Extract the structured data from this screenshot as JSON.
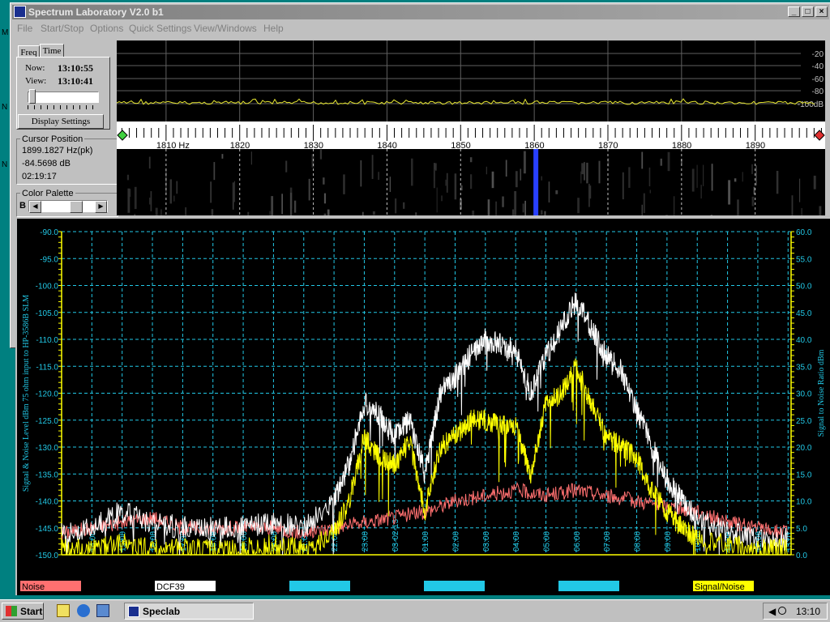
{
  "window": {
    "title": "Spectrum Laboratory V2.0 b1",
    "buttons": {
      "minimize": "_",
      "maximize": "□",
      "close": "×"
    }
  },
  "menu": [
    "File",
    "Start/Stop",
    "Options",
    "Quick Settings",
    "View/Windows",
    "Help"
  ],
  "left_panel": {
    "tabs": [
      "Freq",
      "Time"
    ],
    "now_label": "Now:",
    "now_value": "13:10:55",
    "view_label": "View:",
    "view_value": "13:10:41",
    "display_settings": "Display Settings",
    "cursor_title": "Cursor Position",
    "cursor_freq": "1899.1827 Hz(pk)",
    "cursor_level": "-84.5698 dB",
    "cursor_time": "02:19:17",
    "palette_title": "Color Palette",
    "palette_b": "B",
    "side_letters": [
      "M",
      "N",
      "N"
    ]
  },
  "spectrum": {
    "db_labels": [
      "-20",
      "-40",
      "-60",
      "-80",
      "-100dB"
    ],
    "freq_labels": [
      "1810 Hz",
      "1820",
      "1830",
      "1840",
      "1850",
      "1860",
      "1870",
      "1880",
      "1890"
    ],
    "freq_values": [
      1810,
      1820,
      1830,
      1840,
      1850,
      1860,
      1870,
      1880,
      1890
    ],
    "colors": {
      "trace": "#e8e830",
      "grid": "#606060",
      "waterfall_mark": "#2840ff"
    }
  },
  "chart_data": {
    "type": "line",
    "left_axis_label": "Signal & Noise Level  dBm 75 ohm input to HP-3586B SLM",
    "right_axis_label": "Signal to Noise Ratio  dBm",
    "ylim": [
      -150,
      -90
    ],
    "y2lim": [
      0,
      60
    ],
    "y_ticks": [
      "-90.0",
      "-95.0",
      "-100.0",
      "-105.0",
      "-110.0",
      "-115.0",
      "-120.0",
      "-125.0",
      "-130.0",
      "-135.0",
      "-140.0",
      "-145.0",
      "-150.0"
    ],
    "y2_ticks": [
      "60.0",
      "55.0",
      "50.0",
      "45.0",
      "40.0",
      "35.0",
      "30.0",
      "25.0",
      "20.0",
      "15.0",
      "10.0",
      "5.0",
      "0.0"
    ],
    "x_tick_labels": [
      "14:00",
      "15:00",
      "16:00",
      "17:00",
      "18:00",
      "19:00",
      "20:00",
      "21:00",
      "22:00",
      "23:00",
      "03-02-13",
      "01:00",
      "02:00",
      "03:00",
      "04:00",
      "05:00",
      "06:00",
      "07:00",
      "08:00",
      "09:00",
      "10:00",
      "11:00",
      "12:00",
      "13:01"
    ],
    "x_ticks_hours": [
      14,
      15,
      16,
      17,
      18,
      19,
      20,
      21,
      22,
      23,
      24,
      25,
      26,
      27,
      28,
      29,
      30,
      31,
      32,
      33,
      34,
      35,
      36,
      37
    ],
    "xlim_hours": [
      13.0,
      37.1
    ],
    "series": [
      {
        "name": "Noise",
        "color": "#ff7070",
        "axis": "left",
        "x": [
          13,
          14,
          15,
          16,
          17,
          18,
          19,
          20,
          21,
          22,
          23,
          24,
          25,
          26,
          27,
          28,
          29,
          30,
          31,
          32,
          33,
          34,
          35,
          36,
          37
        ],
        "values": [
          -146,
          -145,
          -144,
          -143,
          -145,
          -145,
          -145,
          -145,
          -146,
          -145,
          -144,
          -143,
          -142,
          -140,
          -139,
          -138,
          -139,
          -138,
          -139,
          -140,
          -141,
          -142,
          -144,
          -145,
          -146
        ]
      },
      {
        "name": "DCF39",
        "color": "#ffffff",
        "axis": "left",
        "x": [
          13,
          14,
          15,
          16,
          17,
          18,
          19,
          20,
          21,
          22,
          22.5,
          23,
          23.5,
          24,
          24.5,
          25,
          25.5,
          26,
          26.5,
          27,
          27.5,
          28,
          28.5,
          29,
          29.5,
          30,
          30.5,
          31,
          31.5,
          32,
          32.5,
          33,
          33.5,
          34,
          35,
          36,
          37
        ],
        "values": [
          -146,
          -145,
          -142,
          -144,
          -145,
          -145,
          -145,
          -144,
          -145,
          -140,
          -133,
          -122,
          -124,
          -128,
          -125,
          -135,
          -120,
          -117,
          -113,
          -110,
          -111,
          -112,
          -120,
          -113,
          -108,
          -103,
          -108,
          -113,
          -116,
          -123,
          -130,
          -136,
          -140,
          -143,
          -146,
          -147,
          -147
        ]
      },
      {
        "name": "Signal/Noise",
        "color": "#ffff00",
        "axis": "right",
        "x": [
          13,
          14,
          15,
          16,
          17,
          18,
          19,
          20,
          21,
          22,
          22.5,
          23,
          23.5,
          24,
          24.5,
          25,
          25.5,
          26,
          26.5,
          27,
          27.5,
          28,
          28.5,
          29,
          29.5,
          30,
          30.5,
          31,
          31.5,
          32,
          32.5,
          33,
          33.5,
          34,
          35,
          36,
          37
        ],
        "values": [
          1,
          1,
          2,
          1,
          1,
          1,
          1,
          2,
          1,
          4,
          10,
          22,
          18,
          17,
          21,
          8,
          20,
          22,
          25,
          25,
          24,
          24,
          15,
          28,
          30,
          35,
          28,
          22,
          20,
          18,
          12,
          8,
          5,
          3,
          2,
          1,
          1
        ]
      }
    ],
    "legend_slots": [
      "Noise",
      "DCF39",
      "",
      "",
      "",
      "Signal/Noise"
    ],
    "legend_colors": [
      "#ff7070",
      "#ffffff",
      "#22c8e6",
      "#22c8e6",
      "#22c8e6",
      "#ffff00"
    ],
    "colors": {
      "axis": "#ffff00",
      "grid": "#22c8e6",
      "tick_text": "#22c8e6"
    }
  },
  "taskbar": {
    "start": "Start",
    "task": "Speclab",
    "clock": "13:10"
  }
}
